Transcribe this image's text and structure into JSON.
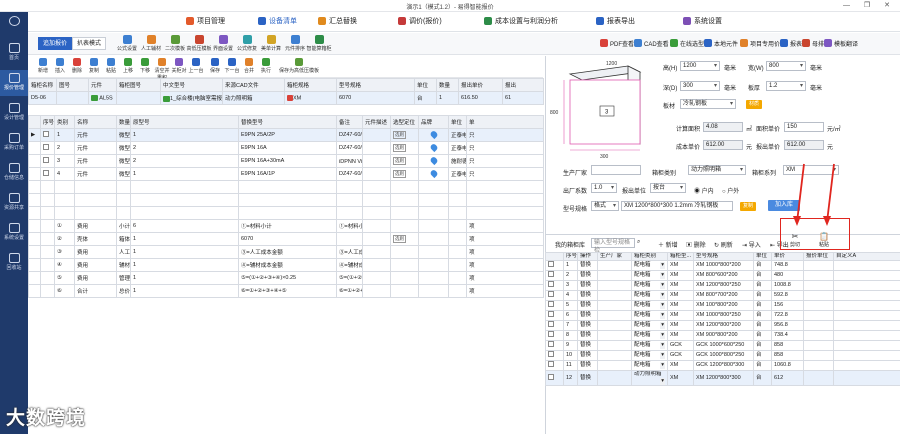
{
  "window": {
    "title": "演示1（模式1.2）- 易得智能报价",
    "controls": "— ❐ ✕"
  },
  "nav": [
    {
      "label": "首页"
    },
    {
      "label": "报价管理"
    },
    {
      "label": "设计管理"
    },
    {
      "label": "采购订单"
    },
    {
      "label": "仓储信息"
    },
    {
      "label": "资源共享"
    },
    {
      "label": "系统设置"
    },
    {
      "label": "回收站"
    }
  ],
  "top_menu": [
    {
      "label": "项目管理",
      "color": "#e35a2b"
    },
    {
      "label": "设备清单",
      "color": "#2b63c4"
    },
    {
      "label": "汇总替换",
      "color": "#e08a1e"
    },
    {
      "label": "调价(报价)",
      "color": "#c53a3a"
    },
    {
      "label": "成本设置与利润分析",
      "color": "#2d8c48"
    },
    {
      "label": "报表导出",
      "color": "#2b63c4"
    },
    {
      "label": "系统设置",
      "color": "#7d4fb5"
    }
  ],
  "modes": {
    "a": "追加报价",
    "b": "扒表模式"
  },
  "tools1": [
    {
      "label": "公式设置",
      "color": "#3d7fd1"
    },
    {
      "label": "人工辅材",
      "color": "#e0812a"
    },
    {
      "label": "二次模板",
      "color": "#5a9a38"
    },
    {
      "label": "高低压模板",
      "color": "#c9452f"
    },
    {
      "label": "界面设置",
      "color": "#7d57c2"
    },
    {
      "label": "公式修复",
      "color": "#2f9fa8"
    },
    {
      "label": "美单计算",
      "color": "#d2a425"
    },
    {
      "label": "元件排序",
      "color": "#3d7fd1"
    },
    {
      "label": "智能算箱柜",
      "color": "#2d8c48"
    }
  ],
  "tools1_right": [
    {
      "label": "PDF查看",
      "color": "#d9423a"
    },
    {
      "label": "CAD查看",
      "color": "#3d7fd1"
    },
    {
      "label": "在线选型",
      "color": "#3a9c3a"
    },
    {
      "label": "本地元件",
      "color": "#2b63c4"
    },
    {
      "label": "项目专用价",
      "color": "#e0812a"
    },
    {
      "label": "报表",
      "color": "#2b63c4"
    },
    {
      "label": "母排",
      "color": "#c9452f"
    },
    {
      "label": "模板翻译",
      "color": "#7d57c2"
    }
  ],
  "tools2": [
    "新增",
    "插入",
    "删除",
    "复制",
    "粘贴",
    "上移",
    "下移",
    "清空并重积",
    "关柜对",
    "上一台",
    "保存",
    "下一台",
    "合并",
    "执行",
    "保存为高低压模板"
  ],
  "box_header": [
    "箱柜名称",
    "图号",
    "元件",
    "箱柜图号",
    "中文型号",
    "来源CAD文件",
    "箱柜规格",
    "型号规格",
    "单位",
    "数量",
    "报出单价",
    "报出"
  ],
  "box_row": [
    "D5-06",
    "",
    "AL5S",
    "",
    "1_综合楼(电脑室需报价)",
    "动力照明箱",
    "XM",
    "6070",
    "台",
    "1",
    "616.50",
    "61"
  ],
  "main_header": [
    "",
    "序号",
    "类别",
    "名称",
    "数量",
    "原型号",
    "替换型号",
    "备注",
    "元件描述",
    "选型定位",
    "品牌",
    "单位",
    "单"
  ],
  "main_rows": [
    {
      "sel": true,
      "no": "1",
      "cat": "元件",
      "name": "微型断路器",
      "qty": "1",
      "orig": "E9PN 25A/2P",
      "rep": "DZ47-60/2P C25A",
      "brand": "正泰电器",
      "unit": "只"
    },
    {
      "sel": false,
      "no": "2",
      "cat": "元件",
      "name": "微型断路器",
      "qty": "2",
      "orig": "E9PN 16A",
      "rep": "DZ47-60/1P C16A",
      "brand": "正泰电器",
      "unit": "只"
    },
    {
      "sel": false,
      "no": "3",
      "cat": "元件",
      "name": "微型漏电断路器",
      "qty": "2",
      "orig": "E9PN 16A+30mA",
      "rep": "iDPNN Vigi+ (18mm) A型 16A E(",
      "brand": "施耐德电器",
      "unit": "只"
    },
    {
      "sel": false,
      "no": "4",
      "cat": "元件",
      "name": "微型断路器",
      "qty": "1",
      "orig": "E9PN 16A/1P",
      "rep": "DZ47-60/1P C16A",
      "brand": "正泰电器",
      "unit": "只"
    }
  ],
  "summary_rows": [
    {
      "code": "①",
      "cat": "费用",
      "name": "小计",
      "qty": "6",
      "orig": "①=材料小计",
      "rep": "①=材料小计",
      "unit": "项"
    },
    {
      "code": "②",
      "cat": "壳体",
      "name": "箱体",
      "qty": "1",
      "orig": "6070",
      "rep": "",
      "unit": "项"
    },
    {
      "code": "③",
      "cat": "费用",
      "name": "人工费",
      "qty": "1",
      "orig": "③=人工成本金额",
      "rep": "③=人工成本金额",
      "unit": "项"
    },
    {
      "code": "④",
      "cat": "费用",
      "name": "辅材费",
      "qty": "1",
      "orig": "④=辅材成本金额",
      "rep": "④=辅材成本金额",
      "unit": "项"
    },
    {
      "code": "⑤",
      "cat": "费用",
      "name": "管理费",
      "qty": "1",
      "orig": "⑤=(①+②+③+④)×0.25",
      "rep": "⑤=(①+②+③+④)×0.25",
      "unit": "项"
    },
    {
      "code": "⑥",
      "cat": "合计",
      "name": "总价",
      "qty": "1",
      "orig": "⑥=①+②+③+④+⑤",
      "rep": "⑥=①+②+③+④+⑤",
      "unit": "项"
    }
  ],
  "tag": "选则",
  "diagram": {
    "w": "1200",
    "d": "300",
    "h": "800",
    "front_label": "3"
  },
  "form": {
    "h_label": "高(H)",
    "h_val": "1200",
    "h_unit": "毫米",
    "w_label": "宽(W)",
    "w_val": "800",
    "w_unit": "毫米",
    "d_label": "深(D)",
    "d_val": "300",
    "d_unit": "毫米",
    "thick_label": "板厚",
    "thick_val": "1.2",
    "thick_unit": "毫米",
    "mat_label": "板材",
    "mat_val": "冷轧钢板",
    "mat_btn": "材质",
    "area_label": "计算面积",
    "area_val": "4.08",
    "area_unit": "㎡",
    "price_label": "面积单价",
    "price_val": "150",
    "price_unit": "元/㎡",
    "cost_label": "成本单价",
    "cost_val": "612.00",
    "cost_unit": "元",
    "quote_label": "报出单价",
    "quote_val": "612.00",
    "quote_unit": "元",
    "maker_label": "生产厂家",
    "maker_val": "",
    "cat_label": "箱柜类别",
    "cat_val": "动力照明箱",
    "ser_label": "箱柜系列",
    "ser_val": "XM",
    "coef_label": "出厂系数",
    "coef_val": "1.0",
    "rep_label": "报出单位",
    "rep_val": "按台",
    "in_label": "户内",
    "out_label": "户外",
    "spec_label": "型号规格",
    "spec_mode": "格式",
    "spec_val": "XM 1200*800*300 1.2mm 冷轧钢板",
    "copy_btn": "复制",
    "add_btn": "加入库"
  },
  "lib": {
    "title": "我的箱柜库",
    "search_placeholder": "输入型号规格检",
    "new": "新增",
    "del": "删除",
    "refresh": "刷新",
    "import": "导入",
    "export": "导出",
    "cut": "剪切",
    "paste": "粘贴"
  },
  "lib_header": [
    "",
    "序号",
    "操作",
    "生产厂家",
    "箱柜类别",
    "箱柜型...",
    "型号规格",
    "单位",
    "单价",
    "报价单位",
    "自定义A"
  ],
  "lib_rows": [
    {
      "no": "1",
      "op": "替换",
      "cat": "配电箱",
      "ser": "XM",
      "spec": "XM 1000*800*200",
      "unit": "台",
      "price": "748.8"
    },
    {
      "no": "2",
      "op": "替换",
      "cat": "配电箱",
      "ser": "XM",
      "spec": "XM 800*600*200",
      "unit": "台",
      "price": "480"
    },
    {
      "no": "3",
      "op": "替换",
      "cat": "配电箱",
      "ser": "XM",
      "spec": "XM 1200*800*250",
      "unit": "台",
      "price": "1008.8"
    },
    {
      "no": "4",
      "op": "替换",
      "cat": "配电箱",
      "ser": "XM",
      "spec": "XM 800*700*200",
      "unit": "台",
      "price": "592.8"
    },
    {
      "no": "5",
      "op": "替换",
      "cat": "配电箱",
      "ser": "XM",
      "spec": "XM 100*800*200",
      "unit": "台",
      "price": "156"
    },
    {
      "no": "6",
      "op": "替换",
      "cat": "配电箱",
      "ser": "XM",
      "spec": "XM 1000*800*250",
      "unit": "台",
      "price": "722.8"
    },
    {
      "no": "7",
      "op": "替换",
      "cat": "配电箱",
      "ser": "XM",
      "spec": "XM 1200*800*200",
      "unit": "台",
      "price": "956.8"
    },
    {
      "no": "8",
      "op": "替换",
      "cat": "配电箱",
      "ser": "XM",
      "spec": "XM 900*800*200",
      "unit": "台",
      "price": "738.4"
    },
    {
      "no": "9",
      "op": "替换",
      "cat": "配电箱",
      "ser": "GCK",
      "spec": "GCK 1000*600*250",
      "unit": "台",
      "price": "858"
    },
    {
      "no": "10",
      "op": "替换",
      "cat": "配电箱",
      "ser": "GCK",
      "spec": "GCK 1000*800*250",
      "unit": "台",
      "price": "858"
    },
    {
      "no": "11",
      "op": "替换",
      "cat": "配电箱",
      "ser": "XM",
      "spec": "GCK 1200*800*300",
      "unit": "台",
      "price": "1060.8"
    },
    {
      "no": "12",
      "op": "替换",
      "cat": "动力照明箱",
      "ser": "XM",
      "spec": "XM 1200*800*300",
      "unit": "台",
      "price": "612"
    }
  ],
  "watermark": "大数跨境"
}
